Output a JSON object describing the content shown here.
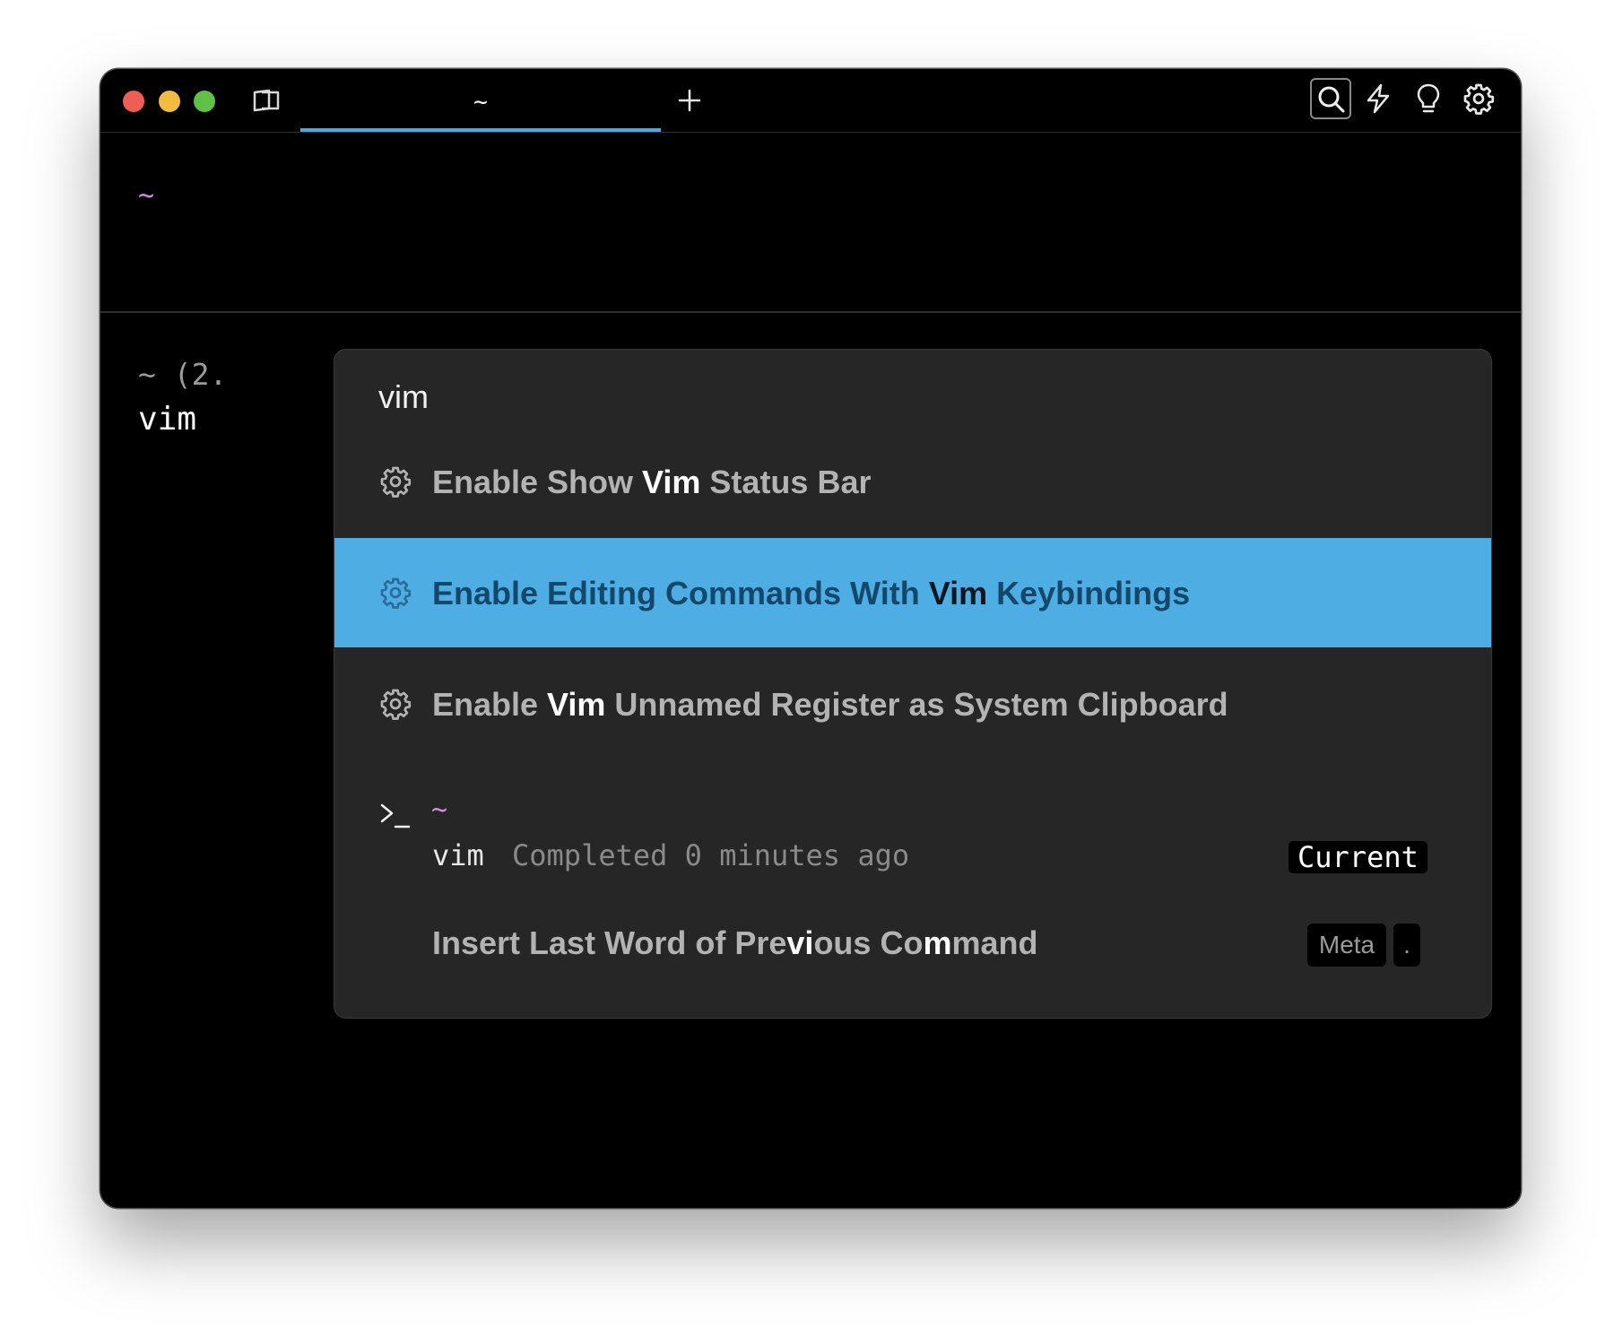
{
  "window": {
    "tab_title": "~"
  },
  "icons": {
    "traffic_close": "close-dot",
    "traffic_minimize": "minimize-dot",
    "traffic_maximize": "maximize-dot",
    "tab_toggle": "tabs-panel-icon",
    "new_tab": "plus-icon",
    "search": "search-icon",
    "workflows": "lightning-icon",
    "ideas": "lightbulb-icon",
    "settings": "gear-icon"
  },
  "colors": {
    "accent": "#4aa7e0",
    "selection": "#4eaee3",
    "prompt": "#d48be0",
    "traffic_close": "#ee5e55",
    "traffic_minimize": "#f2bc3f",
    "traffic_maximize": "#5fc246"
  },
  "terminal": {
    "prompt": "~",
    "block_header": "~ (2.",
    "block_command": "vim"
  },
  "palette": {
    "query": "vim",
    "items": [
      {
        "before": "Enable Show ",
        "match": "Vim",
        "after": " Status Bar",
        "icon": "gear-icon",
        "selected": false
      },
      {
        "before": "Enable Editing Commands With ",
        "match": "Vim",
        "after": " Keybindings",
        "icon": "gear-icon",
        "selected": true
      },
      {
        "before": "Enable ",
        "match": "Vim",
        "after": " Unnamed Register as System Clipboard",
        "icon": "gear-icon",
        "selected": false
      }
    ],
    "history": {
      "icon": "terminal-prompt-icon",
      "directory": "~",
      "command": "vim",
      "meta": "Completed 0 minutes ago",
      "badge": "Current"
    },
    "action": {
      "p1": "Insert Last Word of Pre",
      "m1": "vi",
      "p2": "ous Co",
      "m2": "m",
      "p3": "mand",
      "shortcut": [
        "Meta",
        "."
      ]
    }
  }
}
